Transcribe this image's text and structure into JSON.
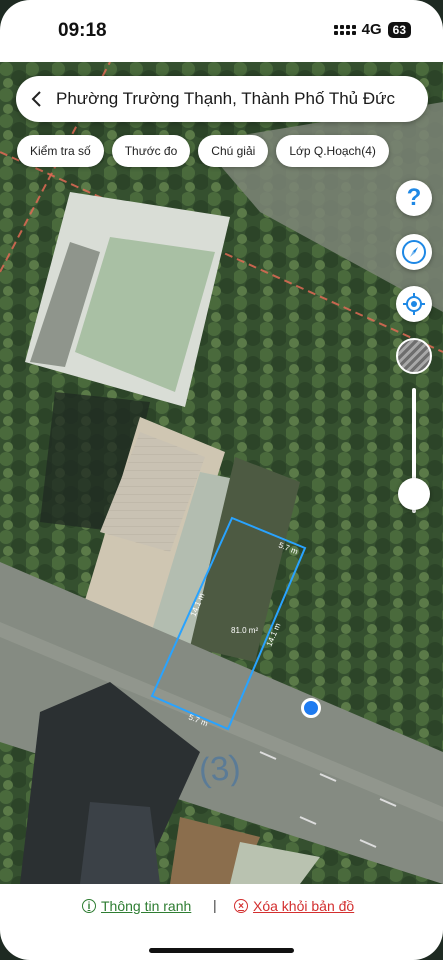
{
  "status_bar": {
    "time": "09:18",
    "network": "4G",
    "battery": "63"
  },
  "search": {
    "location_title": "Phường Trường Thạnh, Thành Phố Thủ Đức"
  },
  "chips": [
    {
      "label": "Kiểm tra số"
    },
    {
      "label": "Thước đo"
    },
    {
      "label": "Chú giải"
    },
    {
      "label": "Lớp Q.Hoạch(4)"
    }
  ],
  "parcel": {
    "area": "81.0 m²",
    "side_top": "5.7 m",
    "side_bottom": "5.7 m",
    "side_left": "14.1 m",
    "side_right": "14.1 m",
    "outline_color": "#29a3ff"
  },
  "map_labels": {
    "road_number": "(3)"
  },
  "zoom_level_fraction": 0.15,
  "icons": {
    "back": "chevron-left-icon",
    "help": "question-icon",
    "compass": "compass-icon",
    "locate": "crosshair-icon",
    "layers": "layer-icon"
  },
  "bottom_bar": {
    "info_label": "Thông tin ranh",
    "separator": "|",
    "remove_label": "Xóa khỏi bản đồ",
    "info_color": "#2e7d32",
    "remove_color": "#d32f2f"
  }
}
